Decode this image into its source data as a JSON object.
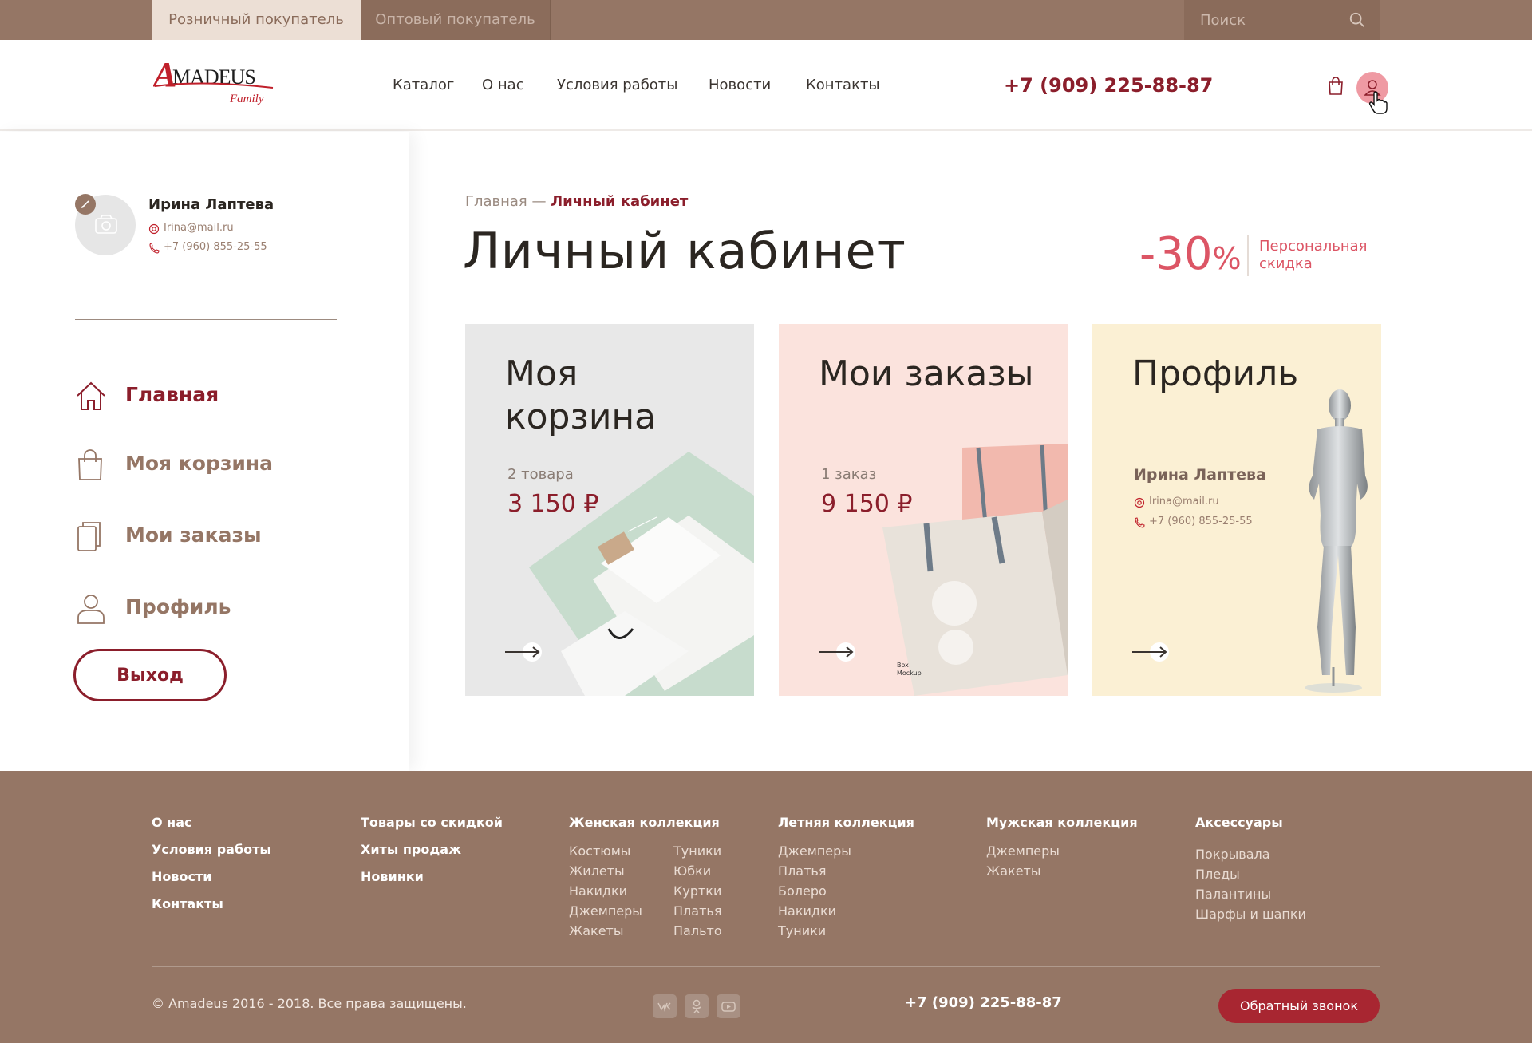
{
  "topbar": {
    "tabs": [
      {
        "label": "Розничный покупатель",
        "active": true
      },
      {
        "label": "Оптовый покупатель",
        "active": false
      }
    ],
    "search": {
      "placeholder": "Поиск"
    }
  },
  "header": {
    "logo_text": "AMADEUS",
    "logo_sub": "Family",
    "nav": [
      "Каталог",
      "О нас",
      "Условия работы",
      "Новости",
      "Контакты"
    ],
    "phone": "+7 (909) 225-88-87"
  },
  "sidebar": {
    "user": {
      "name": "Ирина Лаптева",
      "email": "Irina@mail.ru",
      "phone": "+7 (960) 855-25-55"
    },
    "menu": [
      {
        "label": "Главная",
        "icon": "home-icon",
        "active": true
      },
      {
        "label": "Моя корзина",
        "icon": "bag-icon",
        "active": false
      },
      {
        "label": "Мои заказы",
        "icon": "orders-icon",
        "active": false
      },
      {
        "label": "Профиль",
        "icon": "profile-icon",
        "active": false
      }
    ],
    "logout_label": "Выход"
  },
  "main": {
    "breadcrumb": {
      "home": "Главная",
      "separator": "—",
      "current": "Личный кабинет"
    },
    "title": "Личный кабинет",
    "discount": {
      "value": "-30",
      "unit": "%",
      "label": "Персональная скидка"
    },
    "cards": {
      "cart": {
        "title": "Моя корзина",
        "sub": "2 товара",
        "price": "3 150 ₽"
      },
      "orders": {
        "title": "Мои заказы",
        "sub": "1 заказ",
        "price": "9 150 ₽"
      },
      "profile": {
        "title": "Профиль",
        "name": "Ирина Лаптева",
        "email": "Irina@mail.ru",
        "phone": "+7 (960) 855-25-55"
      }
    }
  },
  "footer": {
    "col1": [
      "О нас",
      "Условия работы",
      "Новости",
      "Контакты"
    ],
    "col2": [
      "Товары со скидкой",
      "Хиты продаж",
      "Новинки"
    ],
    "women": {
      "title": "Женская коллекция",
      "left": [
        "Костюмы",
        "Жилеты",
        "Накидки",
        "Джемперы",
        "Жакеты"
      ],
      "right": [
        "Туники",
        "Юбки",
        "Куртки",
        "Платья",
        "Пальто"
      ]
    },
    "summer": {
      "title": "Летняя коллекция",
      "items": [
        "Джемперы",
        "Платья",
        "Болеро",
        "Накидки",
        "Туники"
      ]
    },
    "men": {
      "title": "Мужская коллекция",
      "items": [
        "Джемперы",
        "Жакеты"
      ]
    },
    "accessories": {
      "title": "Аксессуары",
      "items": [
        "Покрывала",
        "Пледы",
        "Палантины",
        "Шарфы и шапки"
      ]
    },
    "copyright": "© Amadeus 2016 - 2018. Все права защищены.",
    "phone": "+7 (909) 225-88-87",
    "callback_label": "Обратный звонок",
    "social": [
      "vk-icon",
      "odnoklassniki-icon",
      "youtube-icon"
    ]
  },
  "colors": {
    "brand_brown": "#957665",
    "accent_red": "#8b1e2b",
    "discount_pink": "#dc5565"
  }
}
